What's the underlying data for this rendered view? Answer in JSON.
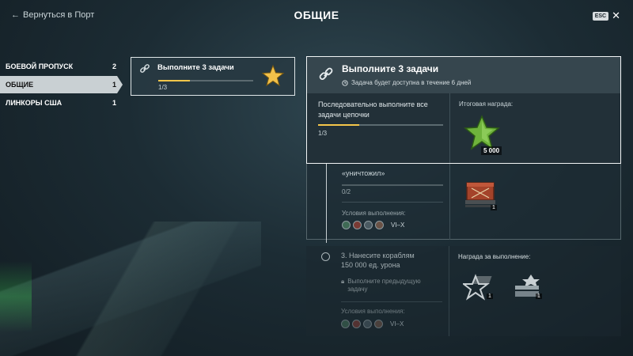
{
  "header": {
    "back_label": "Вернуться в Порт",
    "title": "ОБЩИЕ",
    "esc_label": "ESC"
  },
  "sidebar": {
    "items": [
      {
        "label": "БОЕВОЙ ПРОПУСК",
        "count": "2",
        "active": false
      },
      {
        "label": "ОБЩИЕ",
        "count": "1",
        "active": true
      },
      {
        "label": "ЛИНКОРЫ США",
        "count": "1",
        "active": false
      }
    ]
  },
  "task_card": {
    "title": "Выполните 3 задачи",
    "progress_text": "1/3",
    "progress": 0.33
  },
  "detail": {
    "title": "Выполните 3 задачи",
    "availability": "Задача будет доступна в течение 6 дней",
    "description": "Последовательно выполните все задачи цепочки",
    "progress_text": "1/3",
    "progress": 0.33,
    "reward_label": "Итоговая награда:",
    "reward_amount": "5 000"
  },
  "step2": {
    "text_fragment": "«уничтожил»",
    "progress_text": "0/2",
    "conditions_label": "Условия выполнения:",
    "tiers": "VI–X",
    "reward_count": "1"
  },
  "step3": {
    "title_line1": "3. Нанесите кораблям",
    "title_line2": "150 000 ед. урона",
    "locked_line1": "Выполните предыдущую",
    "locked_line2": "задачу",
    "conditions_label": "Условия выполнения:",
    "tiers": "VI–X",
    "reward_label": "Награда за выполнение:",
    "reward1_count": "1",
    "reward2_count": "1"
  },
  "colors": {
    "accent_gold": "#f5c64a",
    "active_tab": "#c9d0d3",
    "panel_border": "#f2f5f6"
  }
}
